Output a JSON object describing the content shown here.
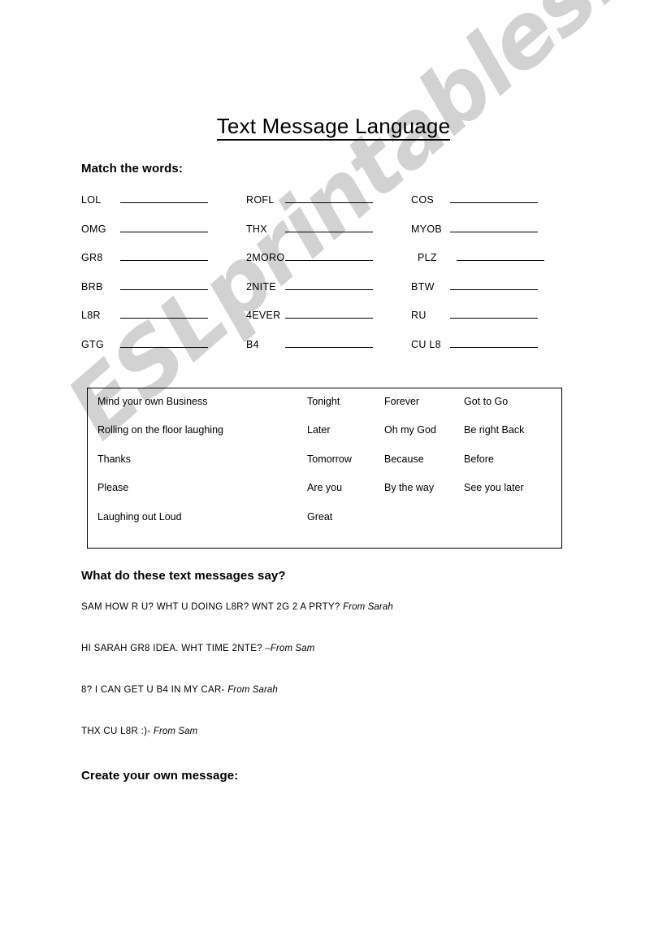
{
  "document": {
    "title": "Text Message Language",
    "watermark": "ESLprintables.com"
  },
  "sections": {
    "match_heading": "Match the words:",
    "messages_heading": "What do these text messages say?",
    "create_heading": "Create your own message:"
  },
  "match": {
    "rows": [
      {
        "col1": "LOL",
        "col2": "ROFL",
        "col3": "COS"
      },
      {
        "col1": "OMG",
        "col2": "THX",
        "col3": "MYOB"
      },
      {
        "col1": "GR8",
        "col2": "2MORO",
        "col3": "PLZ"
      },
      {
        "col1": "BRB",
        "col2": "2NITE",
        "col3": "BTW"
      },
      {
        "col1": "L8R",
        "col2": "4EVER",
        "col3": "RU"
      },
      {
        "col1": "GTG",
        "col2": "B4",
        "col3": "CU L8"
      }
    ]
  },
  "word_bank": {
    "rows": [
      {
        "c1": "Mind your own Business",
        "c2": "Tonight",
        "c3": "Forever",
        "c4": "Got to Go"
      },
      {
        "c1": "Rolling on the floor laughing",
        "c2": "Later",
        "c3": "Oh my God",
        "c4": "Be right Back"
      },
      {
        "c1": "Thanks",
        "c2": "Tomorrow",
        "c3": "Because",
        "c4": "Before"
      },
      {
        "c1": "Please",
        "c2": "Are you",
        "c3": "By the way",
        "c4": "See you later"
      },
      {
        "c1": "Laughing out Loud",
        "c2": "Great",
        "c3": "",
        "c4": ""
      }
    ]
  },
  "messages": [
    {
      "text": "SAM HOW R U? WHT U DOING L8R? WNT 2G  2 A PRTY? ",
      "from": "From Sarah"
    },
    {
      "text": "HI SARAH GR8 IDEA. WHT TIME 2NTE? ",
      "from": "–From Sam"
    },
    {
      "text": "8? I CAN GET  U B4 IN MY CAR- ",
      "from": "From Sarah"
    },
    {
      "text": "THX CU L8R :)- ",
      "from": "From Sam"
    }
  ],
  "colors": {
    "text": "#000000",
    "page_background": "#ffffff",
    "watermark": "#d2d2d2",
    "rule": "#000000"
  }
}
